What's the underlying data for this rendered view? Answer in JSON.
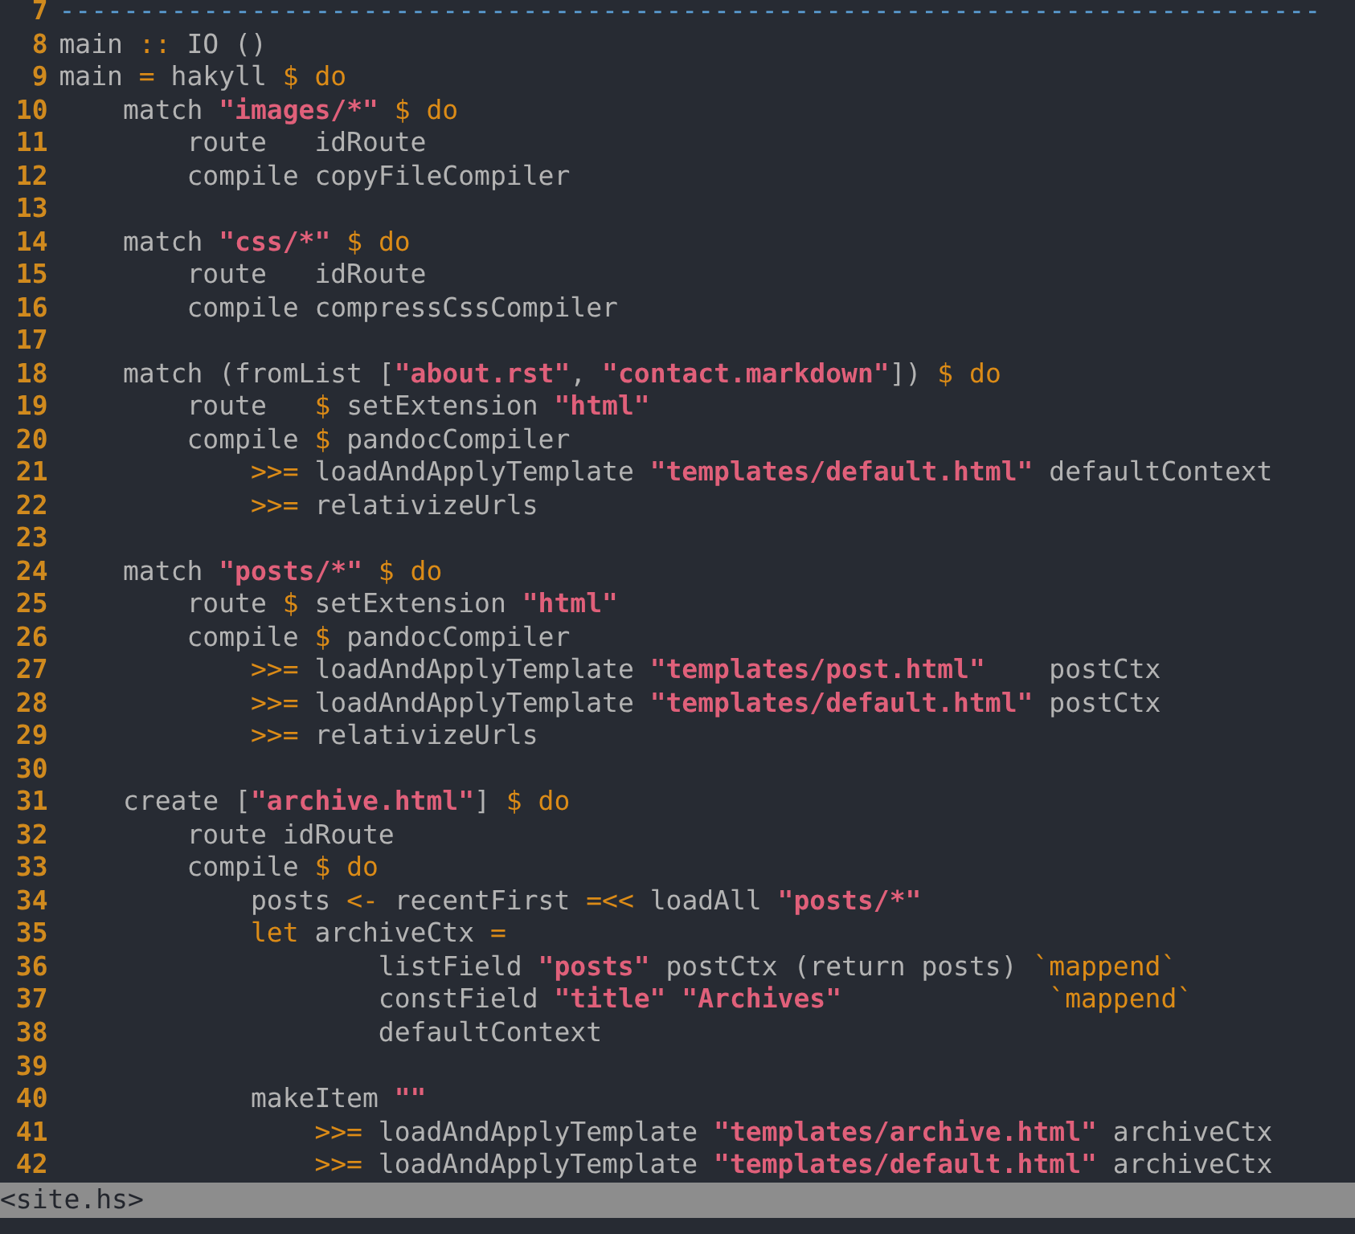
{
  "editor": {
    "lines": [
      {
        "number": "7",
        "segments": [
          {
            "kind": "comment",
            "text": "-------------------------------------------------------------------------------"
          }
        ]
      },
      {
        "number": "8",
        "segments": [
          {
            "kind": "plain",
            "text": "main "
          },
          {
            "kind": "keyword",
            "text": "::"
          },
          {
            "kind": "plain",
            "text": " IO ()"
          }
        ]
      },
      {
        "number": "9",
        "segments": [
          {
            "kind": "plain",
            "text": "main "
          },
          {
            "kind": "keyword",
            "text": "="
          },
          {
            "kind": "plain",
            "text": " hakyll "
          },
          {
            "kind": "keyword",
            "text": "$ do"
          }
        ]
      },
      {
        "number": "10",
        "segments": [
          {
            "kind": "plain",
            "text": "    match "
          },
          {
            "kind": "string",
            "text": "\"images/*\""
          },
          {
            "kind": "keyword",
            "text": " $ do"
          }
        ]
      },
      {
        "number": "11",
        "segments": [
          {
            "kind": "plain",
            "text": "        route   idRoute"
          }
        ]
      },
      {
        "number": "12",
        "segments": [
          {
            "kind": "plain",
            "text": "        compile copyFileCompiler"
          }
        ]
      },
      {
        "number": "13"
      },
      {
        "number": "14",
        "segments": [
          {
            "kind": "plain",
            "text": "    match "
          },
          {
            "kind": "string",
            "text": "\"css/*\""
          },
          {
            "kind": "keyword",
            "text": " $ do"
          }
        ]
      },
      {
        "number": "15",
        "segments": [
          {
            "kind": "plain",
            "text": "        route   idRoute"
          }
        ]
      },
      {
        "number": "16",
        "segments": [
          {
            "kind": "plain",
            "text": "        compile compressCssCompiler"
          }
        ]
      },
      {
        "number": "17"
      },
      {
        "number": "18",
        "segments": [
          {
            "kind": "plain",
            "text": "    match (fromList ["
          },
          {
            "kind": "string",
            "text": "\"about.rst\""
          },
          {
            "kind": "plain",
            "text": ", "
          },
          {
            "kind": "string",
            "text": "\"contact.markdown\""
          },
          {
            "kind": "plain",
            "text": "]) "
          },
          {
            "kind": "keyword",
            "text": "$ do"
          }
        ]
      },
      {
        "number": "19",
        "segments": [
          {
            "kind": "plain",
            "text": "        route   "
          },
          {
            "kind": "keyword",
            "text": "$"
          },
          {
            "kind": "plain",
            "text": " setExtension "
          },
          {
            "kind": "string",
            "text": "\"html\""
          }
        ]
      },
      {
        "number": "20",
        "segments": [
          {
            "kind": "plain",
            "text": "        compile "
          },
          {
            "kind": "keyword",
            "text": "$"
          },
          {
            "kind": "plain",
            "text": " pandocCompiler"
          }
        ]
      },
      {
        "number": "21",
        "segments": [
          {
            "kind": "keyword",
            "text": "            >>="
          },
          {
            "kind": "plain",
            "text": " loadAndApplyTemplate "
          },
          {
            "kind": "string",
            "text": "\"templates/default.html\""
          },
          {
            "kind": "plain",
            "text": " defaultContext"
          }
        ]
      },
      {
        "number": "22",
        "segments": [
          {
            "kind": "keyword",
            "text": "            >>="
          },
          {
            "kind": "plain",
            "text": " relativizeUrls"
          }
        ]
      },
      {
        "number": "23"
      },
      {
        "number": "24",
        "segments": [
          {
            "kind": "plain",
            "text": "    match "
          },
          {
            "kind": "string",
            "text": "\"posts/*\""
          },
          {
            "kind": "keyword",
            "text": " $ do"
          }
        ]
      },
      {
        "number": "25",
        "segments": [
          {
            "kind": "plain",
            "text": "        route "
          },
          {
            "kind": "keyword",
            "text": "$"
          },
          {
            "kind": "plain",
            "text": " setExtension "
          },
          {
            "kind": "string",
            "text": "\"html\""
          }
        ]
      },
      {
        "number": "26",
        "segments": [
          {
            "kind": "plain",
            "text": "        compile "
          },
          {
            "kind": "keyword",
            "text": "$"
          },
          {
            "kind": "plain",
            "text": " pandocCompiler"
          }
        ]
      },
      {
        "number": "27",
        "segments": [
          {
            "kind": "keyword",
            "text": "            >>="
          },
          {
            "kind": "plain",
            "text": " loadAndApplyTemplate "
          },
          {
            "kind": "string",
            "text": "\"templates/post.html\""
          },
          {
            "kind": "plain",
            "text": "    postCtx"
          }
        ]
      },
      {
        "number": "28",
        "segments": [
          {
            "kind": "keyword",
            "text": "            >>="
          },
          {
            "kind": "plain",
            "text": " loadAndApplyTemplate "
          },
          {
            "kind": "string",
            "text": "\"templates/default.html\""
          },
          {
            "kind": "plain",
            "text": " postCtx"
          }
        ]
      },
      {
        "number": "29",
        "segments": [
          {
            "kind": "keyword",
            "text": "            >>="
          },
          {
            "kind": "plain",
            "text": " relativizeUrls"
          }
        ]
      },
      {
        "number": "30"
      },
      {
        "number": "31",
        "segments": [
          {
            "kind": "plain",
            "text": "    create ["
          },
          {
            "kind": "string",
            "text": "\"archive.html\""
          },
          {
            "kind": "plain",
            "text": "] "
          },
          {
            "kind": "keyword",
            "text": "$ do"
          }
        ]
      },
      {
        "number": "32",
        "segments": [
          {
            "kind": "plain",
            "text": "        route idRoute"
          }
        ]
      },
      {
        "number": "33",
        "segments": [
          {
            "kind": "plain",
            "text": "        compile "
          },
          {
            "kind": "keyword",
            "text": "$ do"
          }
        ]
      },
      {
        "number": "34",
        "segments": [
          {
            "kind": "plain",
            "text": "            posts "
          },
          {
            "kind": "keyword",
            "text": "<-"
          },
          {
            "kind": "plain",
            "text": " recentFirst "
          },
          {
            "kind": "keyword",
            "text": "=<<"
          },
          {
            "kind": "plain",
            "text": " loadAll "
          },
          {
            "kind": "string",
            "text": "\"posts/*\""
          }
        ]
      },
      {
        "number": "35",
        "segments": [
          {
            "kind": "keyword",
            "text": "            let"
          },
          {
            "kind": "plain",
            "text": " archiveCtx "
          },
          {
            "kind": "keyword",
            "text": "="
          }
        ]
      },
      {
        "number": "36",
        "segments": [
          {
            "kind": "plain",
            "text": "                    listField "
          },
          {
            "kind": "string",
            "text": "\"posts\""
          },
          {
            "kind": "plain",
            "text": " postCtx (return posts) "
          },
          {
            "kind": "keyword",
            "text": "`mappend`"
          }
        ]
      },
      {
        "number": "37",
        "segments": [
          {
            "kind": "plain",
            "text": "                    constField "
          },
          {
            "kind": "string",
            "text": "\"title\" \"Archives\""
          },
          {
            "kind": "keyword",
            "text": "             `mappend`"
          }
        ]
      },
      {
        "number": "38",
        "segments": [
          {
            "kind": "plain",
            "text": "                    defaultContext"
          }
        ]
      },
      {
        "number": "39"
      },
      {
        "number": "40",
        "segments": [
          {
            "kind": "plain",
            "text": "            makeItem "
          },
          {
            "kind": "string",
            "text": "\"\""
          }
        ]
      },
      {
        "number": "41",
        "segments": [
          {
            "kind": "keyword",
            "text": "                >>="
          },
          {
            "kind": "plain",
            "text": " loadAndApplyTemplate "
          },
          {
            "kind": "string",
            "text": "\"templates/archive.html\""
          },
          {
            "kind": "plain",
            "text": " archiveCtx"
          }
        ]
      },
      {
        "number": "42",
        "segments": [
          {
            "kind": "keyword",
            "text": "                >>="
          },
          {
            "kind": "plain",
            "text": " loadAndApplyTemplate "
          },
          {
            "kind": "string",
            "text": "\"templates/default.html\""
          },
          {
            "kind": "plain",
            "text": " archiveCtx"
          }
        ]
      }
    ]
  },
  "status_bar": {
    "file_name": "<site.hs>"
  }
}
